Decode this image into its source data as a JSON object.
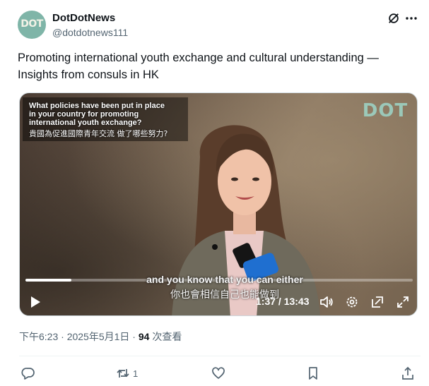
{
  "author": {
    "name": "DotDotNews",
    "handle": "@dotdotnews111",
    "avatar_text": "DOT"
  },
  "tweet": {
    "text_line1": "Promoting international youth exchange and cultural understanding —",
    "text_line2": "Insights from consuls in HK"
  },
  "video": {
    "question_lines": [
      "What policies have been put in place",
      "in your country for promoting",
      "international youth exchange?",
      "貴國為促進國際青年交流 做了哪些努力?"
    ],
    "logo_text": "DOT",
    "subtitle_en": "and you know that you can either",
    "subtitle_zh": "你也會相信自己也能做到",
    "current_time": "1:37",
    "duration": "13:43",
    "time_display": "1:37 / 13:43",
    "progress_fraction": 0.118
  },
  "meta": {
    "timestamp": "下午6:23 · 2025年5月1日 · ",
    "views_count": "94",
    "views_label": " 次查看"
  },
  "actions": {
    "retweet_count": "1"
  },
  "colors": {
    "text": "#0f1419",
    "secondary": "#536471",
    "border": "#cfd9de"
  }
}
